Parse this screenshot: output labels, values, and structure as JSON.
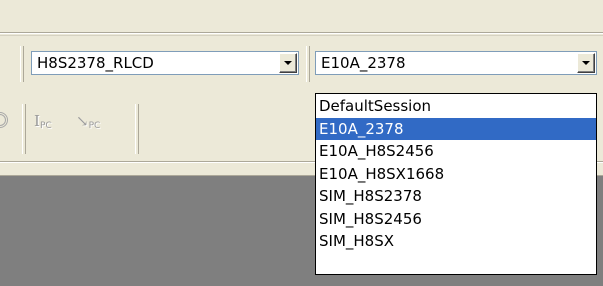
{
  "toolbar": {
    "configuration_combo": {
      "value": "H8S2378_RLCD"
    },
    "session_combo": {
      "value": "E10A_2378"
    },
    "pc_icons": [
      {
        "symbol": "I",
        "sub": "PC",
        "icon": "instruction-at-pc-icon"
      },
      {
        "symbol": "↘",
        "sub": "PC",
        "icon": "step-to-pc-icon"
      }
    ]
  },
  "session_dropdown": {
    "selected_index": 1,
    "options": [
      "DefaultSession",
      "E10A_2378",
      "E10A_H8S2456",
      "E10A_H8SX1668",
      "SIM_H8S2378",
      "SIM_H8S2456",
      "SIM_H8SX"
    ]
  },
  "colors": {
    "window_face": "#ece9d8",
    "selection": "#316ac5",
    "client_area": "#7f7f7f",
    "disabled_icon": "#9a9a9a"
  }
}
